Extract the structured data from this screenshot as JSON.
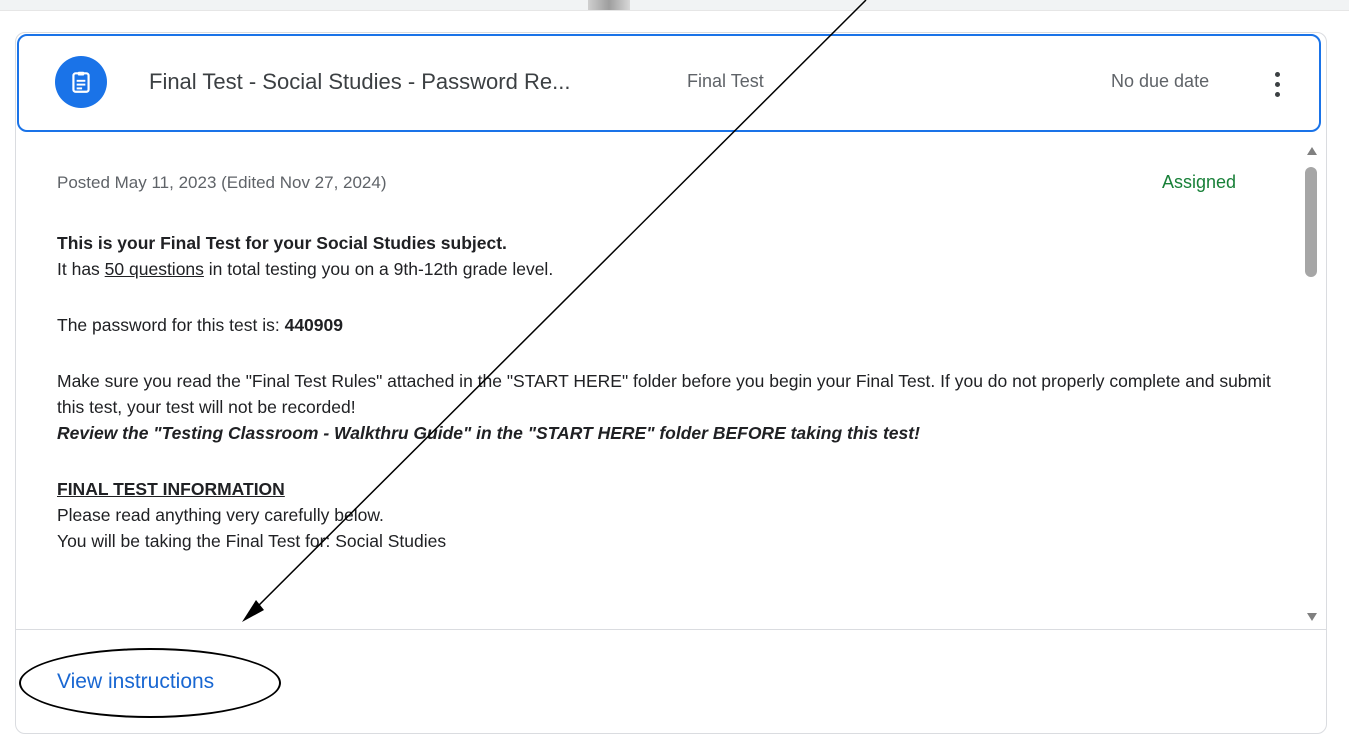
{
  "assignment": {
    "icon": "assignment-icon",
    "title": "Final Test - Social Studies - Password Re...",
    "topic": "Final Test",
    "due": "No due date",
    "more_icon": "more-vert-icon"
  },
  "details": {
    "posted": "Posted May 11, 2023 (Edited Nov 27, 2024)",
    "status": "Assigned",
    "status_color": "#188038",
    "heading": "This is your Final Test for your Social Studies subject.",
    "line1_pre": "It has ",
    "line1_link": "50 questions",
    "line1_post": " in total testing you on a 9th-12th grade level.",
    "password_label": "The password for this test is: ",
    "password": "440909",
    "rules": "Make sure you read the \"Final Test Rules\" attached in the \"START HERE\" folder before you begin your Final Test. If you do not properly complete and submit this test, your test will not be recorded!",
    "review": "Review the \"Testing Classroom - Walkthru Guide\"  in the \"START HERE\" folder BEFORE taking this test!",
    "section_heading": "FINAL TEST INFORMATION",
    "info1": "Please read anything very carefully below.",
    "info2": "You will be taking the Final Test for: Social Studies"
  },
  "footer": {
    "view_label": "View instructions"
  },
  "colors": {
    "accent": "#1a73e8",
    "link": "#1967d2"
  }
}
